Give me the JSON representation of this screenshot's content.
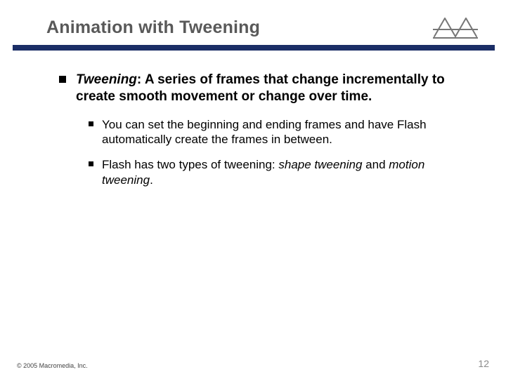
{
  "title": "Animation with Tweening",
  "bullet": {
    "term": "Tweening",
    "rest": ": A series of frames that change incrementally to create smooth movement or change over time."
  },
  "sub": [
    {
      "text": "You can set the beginning and ending frames and have Flash automatically create the frames in between."
    },
    {
      "pre": "Flash has two types of tweening: ",
      "em1": "shape tweening",
      "mid": " and ",
      "em2": "motion tweening",
      "post": "."
    }
  ],
  "footer": {
    "copyright": "© 2005 Macromedia, Inc.",
    "page": "12"
  },
  "colors": {
    "divider": "#1b2e66",
    "title": "#595959"
  }
}
